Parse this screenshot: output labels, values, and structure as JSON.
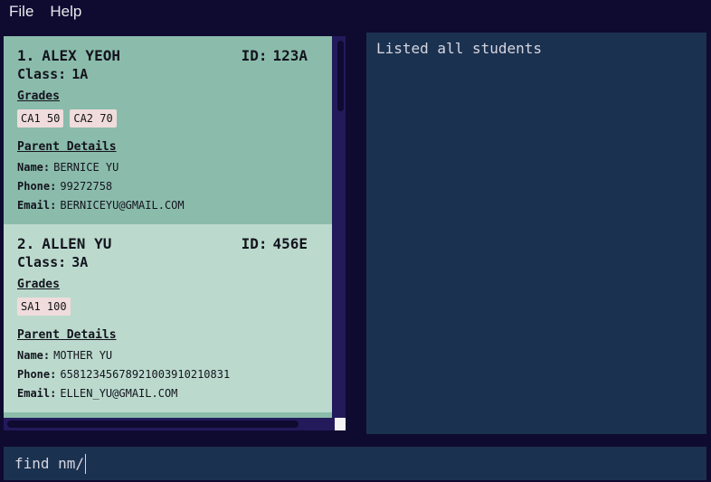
{
  "menu": {
    "file": "File",
    "help": "Help"
  },
  "students": [
    {
      "index": "1.",
      "name": "ALEX YEOH",
      "id_label": "ID:",
      "id": "123A",
      "class_label": "Class:",
      "class": "1A",
      "grades_title": "Grades",
      "grades": [
        "CA1 50",
        "CA2 70"
      ],
      "parent_title": "Parent Details",
      "parent_name_label": "Name:",
      "parent_name": "BERNICE YU",
      "phone_label": "Phone:",
      "phone": "99272758",
      "email_label": "Email:",
      "email": "BERNICEYU@GMAIL.COM",
      "selected": true
    },
    {
      "index": "2.",
      "name": "ALLEN YU",
      "id_label": "ID:",
      "id": "456E",
      "class_label": "Class:",
      "class": "3A",
      "grades_title": "Grades",
      "grades": [
        "SA1 100"
      ],
      "parent_title": "Parent Details",
      "parent_name_label": "Name:",
      "parent_name": "MOTHER YU",
      "phone_label": "Phone:",
      "phone": "658123456789210039102108​31",
      "email_label": "Email:",
      "email": "ELLEN_YU@GMAIL.COM",
      "selected": false
    }
  ],
  "result": {
    "text": "Listed all students"
  },
  "command": {
    "value": "find nm/"
  },
  "colors": {
    "background": "#0f0a30",
    "card_selected": "#8bbcab",
    "card_normal": "#bbdacd",
    "panel": "#1b3150",
    "tag": "#f0dcdc"
  }
}
